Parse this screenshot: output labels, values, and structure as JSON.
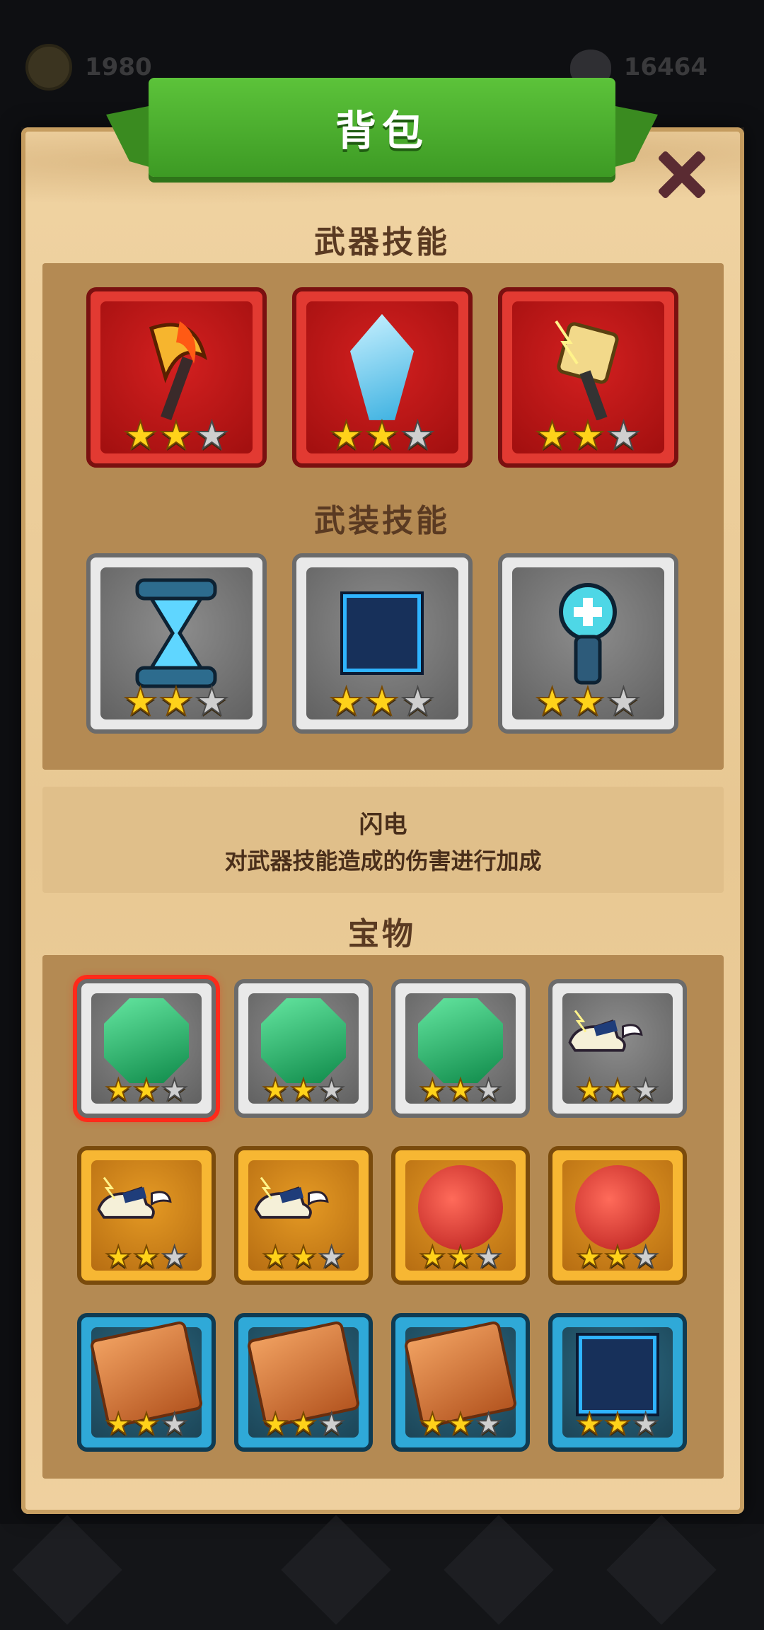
{
  "hud": {
    "coins": "1980",
    "skulls": "16464"
  },
  "dialog": {
    "title": "背包"
  },
  "weapon_skills": {
    "title": "武器技能",
    "items": [
      {
        "icon": "flaming-axe-icon",
        "stars": 2,
        "max_stars": 3,
        "frame": "red"
      },
      {
        "icon": "ice-crystal-icon",
        "stars": 2,
        "max_stars": 3,
        "frame": "red"
      },
      {
        "icon": "lightning-hammer-icon",
        "stars": 2,
        "max_stars": 3,
        "frame": "red"
      }
    ]
  },
  "armor_skills": {
    "title": "武装技能",
    "items": [
      {
        "icon": "hourglass-icon",
        "stars": 2,
        "max_stars": 3,
        "frame": "grey"
      },
      {
        "icon": "energy-cube-icon",
        "stars": 2,
        "max_stars": 3,
        "frame": "grey"
      },
      {
        "icon": "heal-flashlight-icon",
        "stars": 2,
        "max_stars": 3,
        "frame": "grey"
      }
    ]
  },
  "description": {
    "name": "闪电",
    "text": "对武器技能造成的伤害进行加成"
  },
  "treasures": {
    "title": "宝物",
    "items": [
      {
        "icon": "emerald-gem-icon",
        "stars": 2,
        "max_stars": 3,
        "frame": "grey",
        "selected": true
      },
      {
        "icon": "emerald-gem-icon",
        "stars": 2,
        "max_stars": 3,
        "frame": "grey"
      },
      {
        "icon": "emerald-gem-icon",
        "stars": 2,
        "max_stars": 3,
        "frame": "grey"
      },
      {
        "icon": "winged-shoe-icon",
        "stars": 2,
        "max_stars": 3,
        "frame": "grey"
      },
      {
        "icon": "winged-shoe-icon",
        "stars": 2,
        "max_stars": 3,
        "frame": "gold"
      },
      {
        "icon": "winged-shoe-icon",
        "stars": 2,
        "max_stars": 3,
        "frame": "gold"
      },
      {
        "icon": "red-pot-icon",
        "stars": 2,
        "max_stars": 3,
        "frame": "gold"
      },
      {
        "icon": "red-pot-icon",
        "stars": 2,
        "max_stars": 3,
        "frame": "gold"
      },
      {
        "icon": "copper-crate-icon",
        "stars": 2,
        "max_stars": 3,
        "frame": "blue"
      },
      {
        "icon": "copper-crate-icon",
        "stars": 2,
        "max_stars": 3,
        "frame": "blue"
      },
      {
        "icon": "copper-crate-icon",
        "stars": 2,
        "max_stars": 3,
        "frame": "blue"
      },
      {
        "icon": "energy-cube-icon",
        "stars": 2,
        "max_stars": 3,
        "frame": "blue"
      }
    ]
  },
  "colors": {
    "banner": "#4aac2c",
    "parchment": "#ecce9a",
    "star_on": "#ffd21a",
    "selected_border": "#ff2a1a"
  }
}
